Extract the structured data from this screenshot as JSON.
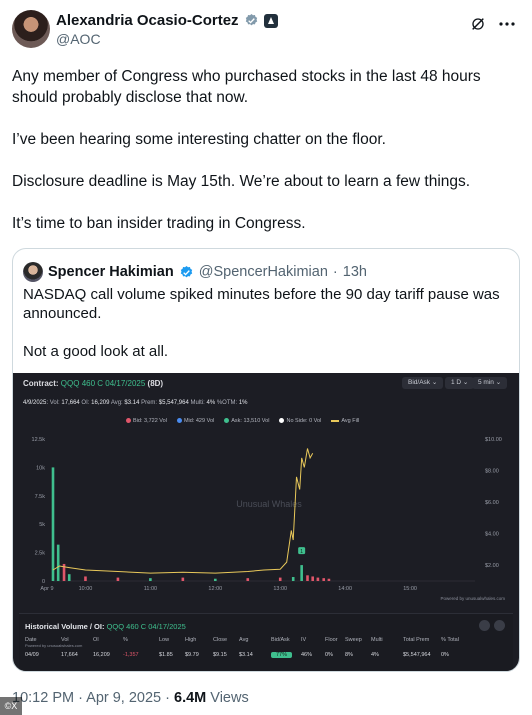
{
  "author": {
    "name": "Alexandria Ocasio-Cortez",
    "handle": "@AOC"
  },
  "tweet": {
    "paragraphs": [
      "Any member of Congress who purchased stocks in the last 48 hours should probably disclose that now.",
      "I’ve been hearing some interesting chatter on the floor.",
      "Disclosure deadline is May 15th. We’re about to learn a few things.",
      "It’s time to ban insider trading in Congress."
    ]
  },
  "quote": {
    "name": "Spencer Hakimian",
    "handle": "@SpencerHakimian",
    "sep": "·",
    "age": "13h",
    "paragraphs": [
      "NASDAQ call volume spiked minutes before the 90 day tariff pause was announced.",
      "Not a good look at all."
    ]
  },
  "chart_panel": {
    "title_prefix": "Contract:",
    "contract": "QQQ 460 C 04/17/2025",
    "dte": "(8D)",
    "controls": [
      "Bid/Ask ⌄",
      "1 D ⌄",
      "5 min ⌄"
    ],
    "stats": {
      "date": "4/9/2025:",
      "vol_label": "Vol:",
      "vol": "17,664",
      "oi_label": "OI:",
      "oi": "16,209",
      "avg_label": "Avg:",
      "avg": "$3.14",
      "prem_label": "Prem:",
      "prem": "$5,547,964",
      "multi_label": "Multi:",
      "multi": "4%",
      "otm_label": "%OTM:",
      "otm": "1%"
    },
    "legend": [
      {
        "label": "Bid: 3,722 Vol",
        "color": "#e0566a"
      },
      {
        "label": "Mid: 429 Vol",
        "color": "#4a8cf0"
      },
      {
        "label": "Ask: 13,510 Vol",
        "color": "#3fbf8e"
      },
      {
        "label": "No Side: 0 Vol",
        "color": "#ffffff"
      },
      {
        "label": "Avg Fill",
        "color": "#e8c85a"
      }
    ],
    "watermark": "Unusual Whales",
    "powered": "Powered by unusualwhales.com"
  },
  "chart_data": {
    "type": "bar",
    "x_ticks": [
      "Apr 9",
      "10:00",
      "11:00",
      "12:00",
      "13:00",
      "14:00",
      "15:00"
    ],
    "y_left_ticks": [
      "0",
      "2.5k",
      "5k",
      "7.5k",
      "10k",
      "12.5k"
    ],
    "y_right_ticks": [
      "$2.00",
      "$4.00",
      "$6.00",
      "$8.00",
      "$10.00"
    ],
    "ylim_volume": [
      0,
      12500
    ],
    "ylim_price": [
      1.0,
      10.0
    ],
    "marker_label": "1",
    "volume_bars": [
      {
        "t": 9.5,
        "side": "ask",
        "v": 10000
      },
      {
        "t": 9.58,
        "side": "ask",
        "v": 3200
      },
      {
        "t": 9.67,
        "side": "bid",
        "v": 1500
      },
      {
        "t": 9.75,
        "side": "ask",
        "v": 600
      },
      {
        "t": 10.0,
        "side": "bid",
        "v": 400
      },
      {
        "t": 10.5,
        "side": "bid",
        "v": 300
      },
      {
        "t": 11.0,
        "side": "ask",
        "v": 250
      },
      {
        "t": 11.5,
        "side": "bid",
        "v": 300
      },
      {
        "t": 12.0,
        "side": "ask",
        "v": 200
      },
      {
        "t": 12.5,
        "side": "bid",
        "v": 250
      },
      {
        "t": 13.0,
        "side": "bid",
        "v": 300
      },
      {
        "t": 13.2,
        "side": "ask",
        "v": 350
      },
      {
        "t": 13.33,
        "side": "ask",
        "v": 1400
      },
      {
        "t": 13.42,
        "side": "bid",
        "v": 500
      },
      {
        "t": 13.5,
        "side": "bid",
        "v": 400
      },
      {
        "t": 13.58,
        "side": "bid",
        "v": 300
      },
      {
        "t": 13.67,
        "side": "bid",
        "v": 250
      },
      {
        "t": 13.75,
        "side": "bid",
        "v": 200
      }
    ],
    "avg_fill": [
      {
        "t": 9.5,
        "p": 1.7
      },
      {
        "t": 9.6,
        "p": 1.95
      },
      {
        "t": 9.75,
        "p": 1.85
      },
      {
        "t": 10.0,
        "p": 1.7
      },
      {
        "t": 10.5,
        "p": 1.6
      },
      {
        "t": 11.0,
        "p": 1.5
      },
      {
        "t": 11.5,
        "p": 1.55
      },
      {
        "t": 12.0,
        "p": 1.5
      },
      {
        "t": 12.5,
        "p": 1.6
      },
      {
        "t": 12.75,
        "p": 1.7
      },
      {
        "t": 13.0,
        "p": 1.75
      },
      {
        "t": 13.1,
        "p": 2.2
      },
      {
        "t": 13.17,
        "p": 4.2
      },
      {
        "t": 13.2,
        "p": 3.6
      },
      {
        "t": 13.25,
        "p": 7.6
      },
      {
        "t": 13.3,
        "p": 6.8
      },
      {
        "t": 13.33,
        "p": 8.8
      },
      {
        "t": 13.37,
        "p": 8.2
      },
      {
        "t": 13.42,
        "p": 9.4
      },
      {
        "t": 13.46,
        "p": 8.8
      },
      {
        "t": 13.5,
        "p": 9.1
      }
    ]
  },
  "history": {
    "title_prefix": "Historical Volume / OI:",
    "contract": "QQQ 460 C 04/17/2025",
    "powered": "Powered by unusualwhales.com",
    "columns": [
      "Date",
      "Vol",
      "OI",
      "%",
      "Low",
      "High",
      "Close",
      "Avg",
      "Bid/Ask",
      "IV",
      "Floor",
      "Sweep",
      "Multi",
      "Total Prem",
      "% Total"
    ],
    "row": [
      "04/09",
      "17,664",
      "16,209",
      "-1,357",
      "$1.85",
      "$9.79",
      "$9.15",
      "$3.14",
      "77%",
      "46%",
      "0%",
      "8%",
      "4%",
      "$5,547,964",
      "0%"
    ]
  },
  "footer": {
    "time": "10:12 PM · Apr 9, 2025 ·",
    "views": "6.4M",
    "views_label": "Views"
  },
  "watermark_corner": "©X",
  "colors": {
    "chart_bg": "#1c1d24",
    "ask": "#3fbf8e",
    "bid": "#e0566a",
    "avg_fill": "#e8c85a",
    "verified": "#1d9bf0"
  }
}
